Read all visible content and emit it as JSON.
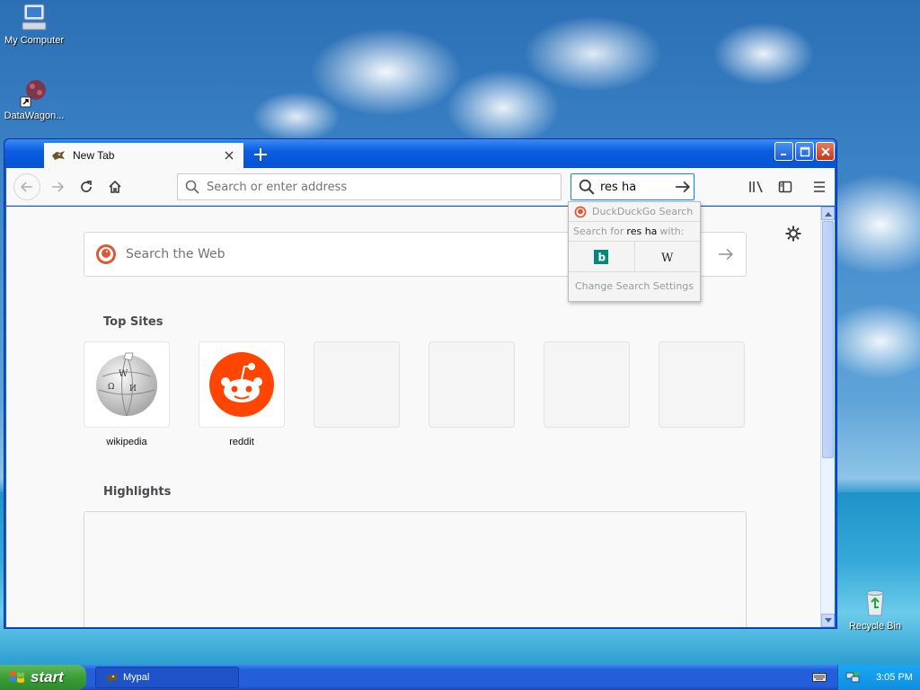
{
  "desktop": {
    "icons": [
      {
        "label": "My Computer"
      },
      {
        "label": "DataWagon..."
      },
      {
        "label": "Recycle Bin"
      }
    ]
  },
  "browser": {
    "tab": {
      "title": "New Tab"
    },
    "urlbar": {
      "placeholder": "Search or enter address"
    },
    "searchbar": {
      "value": "res ha"
    },
    "content": {
      "ddg_placeholder": "Search the Web",
      "top_sites_title": "Top Sites",
      "highlights_title": "Highlights",
      "top_sites": [
        {
          "label": "wikipedia",
          "icon": "wikipedia-globe-icon"
        },
        {
          "label": "reddit",
          "icon": "reddit-alien-icon"
        }
      ]
    },
    "search_popup": {
      "engine_name": "DuckDuckGo Search",
      "search_for_prefix": "Search for",
      "search_for_query": "res ha",
      "search_for_suffix": "with:",
      "engines": [
        {
          "icon": "bing-icon",
          "glyph": "b"
        },
        {
          "icon": "wikipedia-icon",
          "glyph": "W"
        }
      ],
      "settings_label": "Change Search Settings"
    }
  },
  "taskbar": {
    "start_label": "start",
    "task_item": "Mypal",
    "clock": "3:05 PM"
  },
  "colors": {
    "accent": "#0a84ff",
    "xp_blue": "#245edb",
    "start_green": "#3b9e37",
    "reddit_orange": "#ff4500"
  }
}
